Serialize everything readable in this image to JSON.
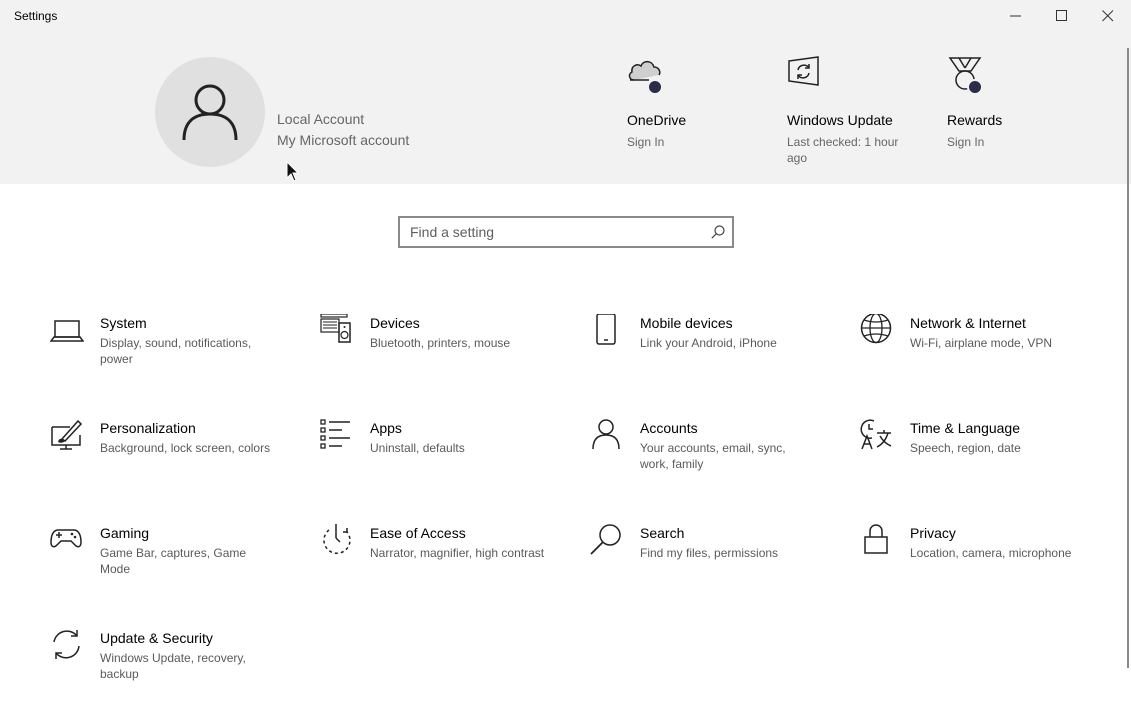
{
  "window": {
    "title": "Settings"
  },
  "account": {
    "name": "Local Account",
    "link": "My Microsoft account"
  },
  "quick_links": [
    {
      "title": "OneDrive",
      "subtitle": "Sign In",
      "icon": "cloud-icon"
    },
    {
      "title": "Windows Update",
      "subtitle": "Last checked: 1 hour ago",
      "icon": "windows-update-icon"
    },
    {
      "title": "Rewards",
      "subtitle": "Sign In",
      "icon": "medal-icon"
    }
  ],
  "search": {
    "placeholder": "Find a setting"
  },
  "categories": [
    {
      "name": "System",
      "desc": "Display, sound, notifications, power",
      "icon": "laptop-icon"
    },
    {
      "name": "Devices",
      "desc": "Bluetooth, printers, mouse",
      "icon": "devices-icon"
    },
    {
      "name": "Mobile devices",
      "desc": "Link your Android, iPhone",
      "icon": "phone-icon"
    },
    {
      "name": "Network & Internet",
      "desc": "Wi-Fi, airplane mode, VPN",
      "icon": "globe-icon"
    },
    {
      "name": "Personalization",
      "desc": "Background, lock screen, colors",
      "icon": "paint-icon"
    },
    {
      "name": "Apps",
      "desc": "Uninstall, defaults",
      "icon": "apps-list-icon"
    },
    {
      "name": "Accounts",
      "desc": "Your accounts, email, sync, work, family",
      "icon": "person-icon"
    },
    {
      "name": "Time & Language",
      "desc": "Speech, region, date",
      "icon": "time-language-icon"
    },
    {
      "name": "Gaming",
      "desc": "Game Bar, captures, Game Mode",
      "icon": "gamepad-icon"
    },
    {
      "name": "Ease of Access",
      "desc": "Narrator, magnifier, high contrast",
      "icon": "ease-of-access-icon"
    },
    {
      "name": "Search",
      "desc": "Find my files, permissions",
      "icon": "search-icon"
    },
    {
      "name": "Privacy",
      "desc": "Location, camera, microphone",
      "icon": "lock-icon"
    },
    {
      "name": "Update & Security",
      "desc": "Windows Update, recovery, backup",
      "icon": "sync-icon"
    }
  ],
  "colors": {
    "header_bg": "#f2f2f2",
    "accent_dot": "#2b2b4a",
    "secondary_text": "#5a5a5a"
  }
}
